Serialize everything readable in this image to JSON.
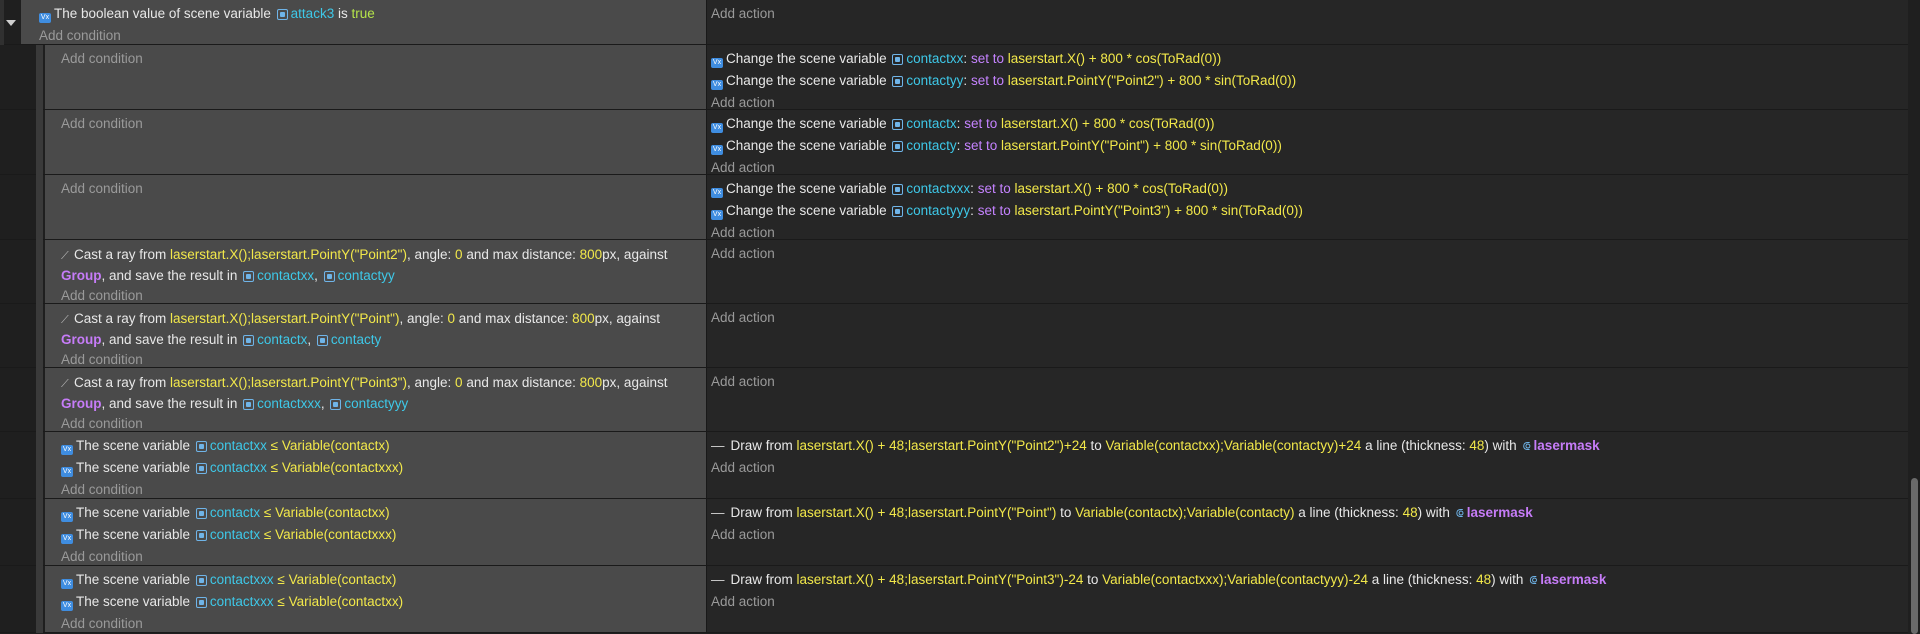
{
  "texts": {
    "add_condition": "Add condition",
    "add_action": "Add action",
    "the_boolean_value_of_scene_variable": "The boolean value of scene variable",
    "is": "is",
    "true": "true",
    "change_the_scene_variable": "Change the scene variable",
    "set_to": "set to",
    "cast_a_ray_from": "Cast a ray from",
    "angle": ", angle:",
    "and_max_distance": "and max distance:",
    "px_against": "px, against",
    "and_save_result_in": ", and save the result in",
    "the_scene_variable": "The scene variable",
    "leq": "≤",
    "draw_from": "Draw from",
    "to": "to",
    "a_line_thickness": "a line (thickness:",
    "with": ") with"
  },
  "event0": {
    "condition_var": "attack3"
  },
  "actions1": [
    {
      "var": "contactxx",
      "expr": "laserstart.X() + 800 * cos(ToRad(0))"
    },
    {
      "var": "contactyy",
      "expr": "laserstart.PointY(\"Point2\") + 800 * sin(ToRad(0))"
    }
  ],
  "actions2": [
    {
      "var": "contactx",
      "expr": "laserstart.X() + 800 * cos(ToRad(0))"
    },
    {
      "var": "contacty",
      "expr": "laserstart.PointY(\"Point\") + 800 * sin(ToRad(0))"
    }
  ],
  "actions3": [
    {
      "var": "contactxxx",
      "expr": "laserstart.X() + 800 * cos(ToRad(0))"
    },
    {
      "var": "contactyyy",
      "expr": "laserstart.PointY(\"Point3\") + 800 * sin(ToRad(0))"
    }
  ],
  "rays": [
    {
      "from": "laserstart.X();laserstart.PointY(\"Point2\")",
      "angle": "0",
      "dist": "800",
      "obj": "Group",
      "vx": "contactxx",
      "vy": "contactyy"
    },
    {
      "from": "laserstart.X();laserstart.PointY(\"Point\")",
      "angle": "0",
      "dist": "800",
      "obj": "Group",
      "vx": "contactx",
      "vy": "contacty"
    },
    {
      "from": "laserstart.X();laserstart.PointY(\"Point3\")",
      "angle": "0",
      "dist": "800",
      "obj": "Group",
      "vx": "contactxxx",
      "vy": "contactyyy"
    }
  ],
  "compares": [
    {
      "conds": [
        {
          "var": "contactxx",
          "expr": "Variable(contactx)"
        },
        {
          "var": "contactxx",
          "expr": "Variable(contactxxx)"
        }
      ],
      "draw": {
        "from": "laserstart.X() + 48;laserstart.PointY(\"Point2\")+24",
        "to": "Variable(contactxx);Variable(contactyy)+24",
        "thickness": "48",
        "obj": "lasermask"
      }
    },
    {
      "conds": [
        {
          "var": "contactx",
          "expr": "Variable(contactxx)"
        },
        {
          "var": "contactx",
          "expr": "Variable(contactxxx)"
        }
      ],
      "draw": {
        "from": "laserstart.X() + 48;laserstart.PointY(\"Point\")",
        "to": "Variable(contactx);Variable(contacty)",
        "thickness": "48",
        "obj": "lasermask"
      }
    },
    {
      "conds": [
        {
          "var": "contactxxx",
          "expr": "Variable(contactx)"
        },
        {
          "var": "contactxxx",
          "expr": "Variable(contactxx)"
        }
      ],
      "draw": {
        "from": "laserstart.X() + 48;laserstart.PointY(\"Point3\")-24",
        "to": "Variable(contactxxx);Variable(contactyyy)-24",
        "thickness": "48",
        "obj": "lasermask"
      }
    }
  ],
  "colors": {
    "variable": "#3ec8e8",
    "expression": "#f2e84a",
    "object": "#c67cf8",
    "background": "#1f1f1f"
  },
  "icons": [
    "collapse-arrow-icon",
    "scene-variable-icon",
    "variable-icon",
    "raycast-icon",
    "draw-line-icon",
    "object-icon"
  ]
}
